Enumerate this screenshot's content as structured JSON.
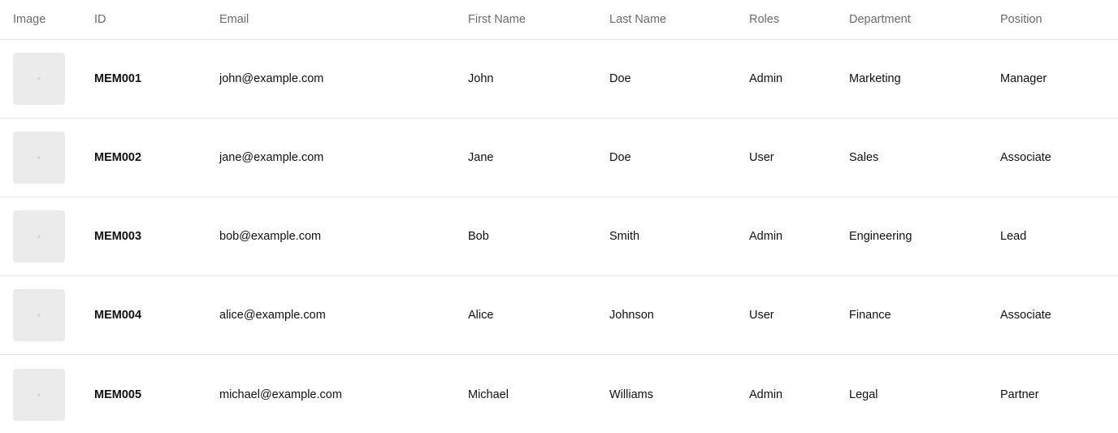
{
  "table": {
    "headers": {
      "image": "Image",
      "id": "ID",
      "email": "Email",
      "first_name": "First Name",
      "last_name": "Last Name",
      "roles": "Roles",
      "department": "Department",
      "position": "Position"
    },
    "rows": [
      {
        "id": "MEM001",
        "email": "john@example.com",
        "first_name": "John",
        "last_name": "Doe",
        "role": "Admin",
        "department": "Marketing",
        "position": "Manager",
        "image_icon": "image-placeholder-icon"
      },
      {
        "id": "MEM002",
        "email": "jane@example.com",
        "first_name": "Jane",
        "last_name": "Doe",
        "role": "User",
        "department": "Sales",
        "position": "Associate",
        "image_icon": "image-placeholder-icon"
      },
      {
        "id": "MEM003",
        "email": "bob@example.com",
        "first_name": "Bob",
        "last_name": "Smith",
        "role": "Admin",
        "department": "Engineering",
        "position": "Lead",
        "image_icon": "image-placeholder-icon"
      },
      {
        "id": "MEM004",
        "email": "alice@example.com",
        "first_name": "Alice",
        "last_name": "Johnson",
        "role": "User",
        "department": "Finance",
        "position": "Associate",
        "image_icon": "image-placeholder-icon"
      },
      {
        "id": "MEM005",
        "email": "michael@example.com",
        "first_name": "Michael",
        "last_name": "Williams",
        "role": "Admin",
        "department": "Legal",
        "position": "Partner",
        "image_icon": "image-placeholder-icon"
      }
    ]
  },
  "colors": {
    "header_text": "#6b6b6b",
    "body_text": "#111111",
    "row_divider": "#e6e6e6",
    "thumbnail_bg": "#ebebeb"
  }
}
